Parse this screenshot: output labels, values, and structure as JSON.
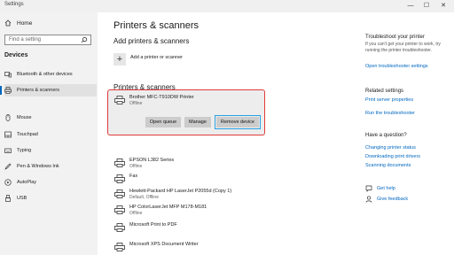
{
  "window": {
    "title": "Settings",
    "min": "—",
    "max": "☐",
    "close": "✕"
  },
  "sidebar": {
    "home": "Home",
    "search_placeholder": "Find a setting",
    "section": "Devices",
    "items": [
      {
        "label": "Bluetooth & other devices",
        "icon": "bluetooth-icon"
      },
      {
        "label": "Printers & scanners",
        "icon": "printer-icon",
        "active": true
      },
      {
        "label": "Mouse",
        "icon": "mouse-icon"
      },
      {
        "label": "Touchpad",
        "icon": "touchpad-icon"
      },
      {
        "label": "Typing",
        "icon": "keyboard-icon"
      },
      {
        "label": "Pen & Windows Ink",
        "icon": "pen-icon"
      },
      {
        "label": "AutoPlay",
        "icon": "autoplay-icon"
      },
      {
        "label": "USB",
        "icon": "usb-icon"
      }
    ]
  },
  "main": {
    "title": "Printers & scanners",
    "add_heading": "Add printers & scanners",
    "add_button": "+",
    "add_label": "Add a printer or scanner",
    "list_heading": "Printers & scanners",
    "printers": [
      {
        "name": "Brother MFC-T910DW Printer",
        "status": "Offline"
      },
      {
        "name": "EPSON L382 Series",
        "status": "Offline"
      },
      {
        "name": "Fax",
        "status": ""
      },
      {
        "name": "Hewlett-Packard HP LaserJet P2055d (Copy 1)",
        "status": "Default, Offline"
      },
      {
        "name": "HP ColorLaserJet MFP M178-M181",
        "status": "Offline"
      },
      {
        "name": "Microsoft Print to PDF",
        "status": ""
      },
      {
        "name": "Microsoft XPS Document Writer",
        "status": ""
      }
    ],
    "buttons": {
      "open": "Open queue",
      "manage": "Manage",
      "remove": "Remove device"
    }
  },
  "right": {
    "troubleshoot_heading": "Troubleshoot your printer",
    "troubleshoot_text": "If you can't get your printer to work, try running the printer troubleshooter.",
    "troubleshoot_link": "Open troubleshooter settings",
    "related_heading": "Related settings",
    "related_links": [
      "Print server properties",
      "Run the troubleshooter"
    ],
    "question_heading": "Have a question?",
    "question_links": [
      "Changing printer status",
      "Downloading print drivers",
      "Scanning documents"
    ],
    "help": "Get help",
    "feedback": "Give feedback"
  },
  "colors": {
    "accent": "#0067c0",
    "highlight_border": "#e23a3a",
    "focus": "#29a0e0"
  }
}
